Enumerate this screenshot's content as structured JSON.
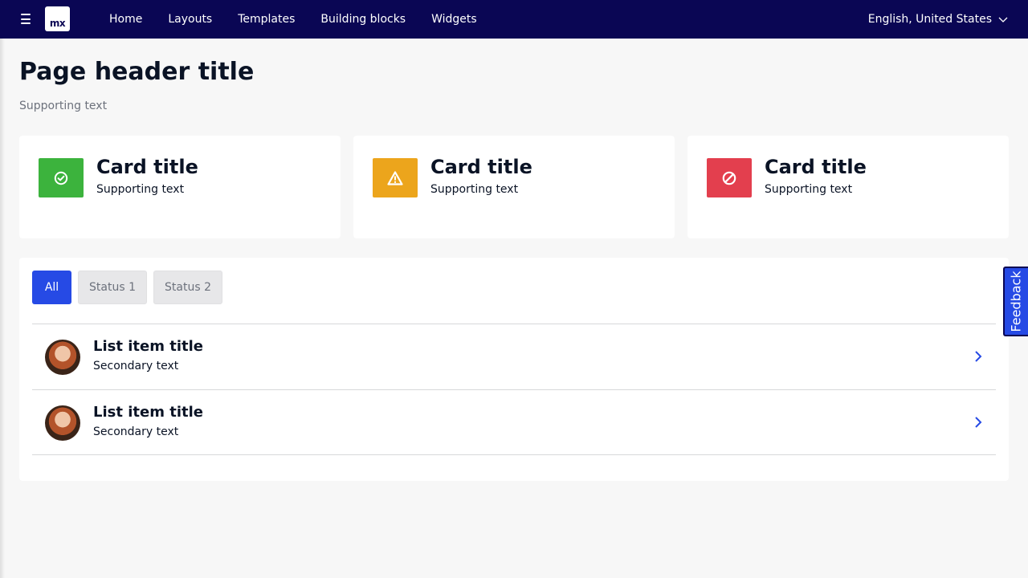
{
  "topbar": {
    "logo_text": "mx",
    "nav": [
      "Home",
      "Layouts",
      "Templates",
      "Building blocks",
      "Widgets"
    ],
    "language": "English, United States"
  },
  "header": {
    "title": "Page header title",
    "subtitle": "Supporting text"
  },
  "cards": [
    {
      "title": "Card title",
      "subtitle": "Supporting text",
      "icon": "check-circle-icon",
      "color": "#3cb33d"
    },
    {
      "title": "Card title",
      "subtitle": "Supporting text",
      "icon": "warning-icon",
      "color": "#eca51c"
    },
    {
      "title": "Card title",
      "subtitle": "Supporting text",
      "icon": "block-icon",
      "color": "#e33f4e"
    }
  ],
  "tabs": {
    "all": "All",
    "status1": "Status 1",
    "status2": "Status 2"
  },
  "list": [
    {
      "title": "List item title",
      "subtitle": "Secondary text"
    },
    {
      "title": "List item title",
      "subtitle": "Secondary text"
    }
  ],
  "feedback": "Feedback",
  "colors": {
    "topbar": "#0a0654",
    "accent": "#264ae5",
    "background": "#f7f7f7"
  }
}
